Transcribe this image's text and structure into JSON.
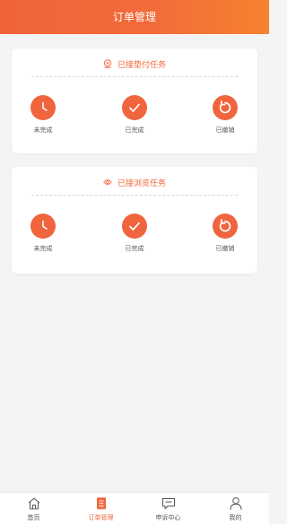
{
  "header": {
    "title": "订单管理"
  },
  "cards": [
    {
      "title": "已接垫付任务",
      "statuses": [
        {
          "label": "未完成",
          "icon": "clock-icon"
        },
        {
          "label": "已完成",
          "icon": "check-icon"
        },
        {
          "label": "已撤销",
          "icon": "undo-icon"
        }
      ]
    },
    {
      "title": "已接浏览任务",
      "statuses": [
        {
          "label": "未完成",
          "icon": "clock-icon"
        },
        {
          "label": "已完成",
          "icon": "check-icon"
        },
        {
          "label": "已撤销",
          "icon": "undo-icon"
        }
      ]
    }
  ],
  "tabbar": {
    "items": [
      {
        "label": "首页",
        "icon": "home-icon",
        "active": false
      },
      {
        "label": "订单管理",
        "icon": "order-list-icon",
        "active": true
      },
      {
        "label": "申诉中心",
        "icon": "appeal-chat-icon",
        "active": false
      },
      {
        "label": "我的",
        "icon": "user-icon",
        "active": false
      }
    ]
  },
  "colors": {
    "accent": "#f0653d",
    "background": "#f4f4f4"
  }
}
